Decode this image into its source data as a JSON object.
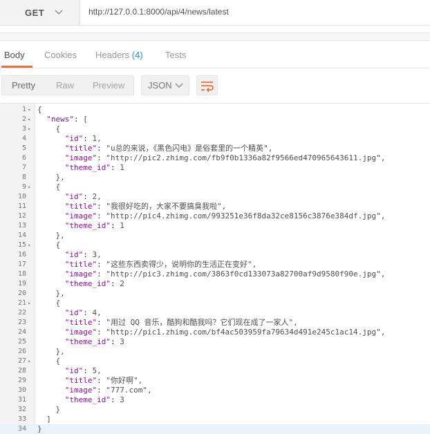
{
  "request": {
    "method": "GET",
    "url": "http://127.0.0.1:8000/api/4/news/latest"
  },
  "response_tabs": [
    {
      "label": "Body"
    },
    {
      "label": "Cookies"
    },
    {
      "label": "Headers",
      "count": "(4)"
    },
    {
      "label": "Tests"
    }
  ],
  "view_modes": [
    "Pretty",
    "Raw",
    "Preview"
  ],
  "format": "JSON",
  "colors": {
    "accent": "#f26b3a",
    "link": "#2a8bd8"
  },
  "icons": {
    "method_dropdown": "chevron-down-icon",
    "format_dropdown": "chevron-down-icon",
    "wrap": "wrap-lines-icon"
  },
  "code_lines": [
    "{",
    "  \"news\": [",
    "    {",
    "      \"id\": 1,",
    "      \"title\": \"u总的来说，《黑色闪电》是俗套里的一个精英\",",
    "      \"image\": \"http://pic2.zhimg.com/fb9f0b1336a82f9566ed470965643611.jpg\",",
    "      \"theme_id\": 1",
    "    },",
    "    {",
    "      \"id\": 2,",
    "      \"title\": \"我很好吃的，大家不要搞臭我啦\",",
    "      \"image\": \"http://pic4.zhimg.com/993251e36f8da32ce8156c3876e384df.jpg\",",
    "      \"theme_id\": 1",
    "    },",
    "    {",
    "      \"id\": 3,",
    "      \"title\": \"这些东西卖得少，说明你的生活正在变好\",",
    "      \"image\": \"http://pic3.zhimg.com/3863f0cd133073a82700af9d9580f90e.jpg\",",
    "      \"theme_id\": 2",
    "    },",
    "    {",
    "      \"id\": 4,",
    "      \"title\": \"用过 QQ 音乐，酷狗和酷我吗？它们现在成了一家人\",",
    "      \"image\": \"http://pic1.zhimg.com/bf4ac503959fa79634d491e245c1ac14.jpg\",",
    "      \"theme_id\": 3",
    "    },",
    "    {",
    "      \"id\": 5,",
    "      \"title\": \"你好啊\",",
    "      \"image\": \"777.com\",",
    "      \"theme_id\": 3",
    "    }",
    "  ]",
    "}"
  ],
  "fold_lines": [
    1,
    2,
    3,
    9,
    15,
    21,
    27
  ]
}
